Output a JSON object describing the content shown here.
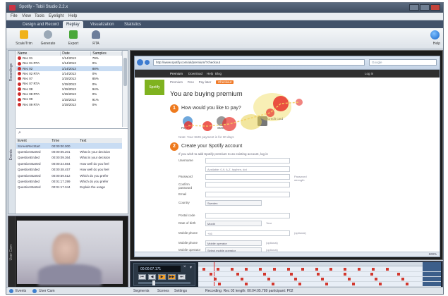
{
  "window": {
    "title": "Spotify - Tobii Studio 2.2.x",
    "colors": {
      "accent": "#ee7a1e",
      "gaze": "#e8322b",
      "titlebar": "#3f4d60"
    }
  },
  "menu": [
    "File",
    "View",
    "Tools",
    "Eyelight",
    "Help"
  ],
  "tabs": [
    "Design and Record",
    "Replay",
    "Visualization",
    "Statistics"
  ],
  "toolbar": {
    "buttons": [
      {
        "label": "Scale/Trim",
        "icon": "scale-icon"
      },
      {
        "label": "Generate",
        "icon": "generate-icon"
      },
      {
        "label": "Export",
        "icon": "export-icon"
      },
      {
        "label": "RTA",
        "icon": "rta-icon"
      }
    ],
    "help_label": "Help"
  },
  "recordings": {
    "panel_label": "Recordings",
    "columns": [
      "Name",
      "Date",
      "Samples"
    ],
    "rows": [
      {
        "name": "Rec 01",
        "date": "1/14/2013",
        "samples": "79%"
      },
      {
        "name": "Rec 01 RTA",
        "date": "1/14/2013",
        "samples": "0%"
      },
      {
        "name": "Rec 02",
        "date": "1/14/2013",
        "samples": "88%"
      },
      {
        "name": "Rec 02 RTA",
        "date": "1/14/2013",
        "samples": "0%"
      },
      {
        "name": "Rec 07",
        "date": "1/15/2013",
        "samples": "85%"
      },
      {
        "name": "Rec 07 RTA",
        "date": "1/15/2013",
        "samples": "0%"
      },
      {
        "name": "Rec 08",
        "date": "1/15/2013",
        "samples": "94%"
      },
      {
        "name": "Rec 08 RTA",
        "date": "1/15/2013",
        "samples": "0%"
      },
      {
        "name": "Rec 09",
        "date": "1/15/2013",
        "samples": "91%"
      },
      {
        "name": "Rec 09 RTA",
        "date": "1/15/2013",
        "samples": "0%"
      }
    ]
  },
  "segments": {
    "panel_label": "Events",
    "columns": [
      "Event",
      "Time",
      "Text"
    ],
    "rows": [
      {
        "event": "ScreenRecStart",
        "time": "00:00:00.000",
        "text": ""
      },
      {
        "event": "QuestionStarted",
        "time": "00:00:05.201",
        "text": "What is your decision"
      },
      {
        "event": "QuestionEnded",
        "time": "00:00:09.364",
        "text": "What is your decision"
      },
      {
        "event": "QuestionStarted",
        "time": "00:00:24.564",
        "text": "How well do you feel"
      },
      {
        "event": "QuestionEnded",
        "time": "00:00:48.457",
        "text": "How well do you feel"
      },
      {
        "event": "QuestionStarted",
        "time": "00:00:59.512",
        "text": "Which do you prefer"
      },
      {
        "event": "QuestionEnded",
        "time": "00:01:17.299",
        "text": "Which do you prefer"
      },
      {
        "event": "QuestionStarted",
        "time": "00:01:17.344",
        "text": "Explain the usage"
      }
    ]
  },
  "side_tabs": {
    "user_cam": "User Cam"
  },
  "browser": {
    "address": "http://www.spotify.com/uk/premium/?checkout",
    "search_placeholder": "Google",
    "site_nav": [
      "Premium",
      "Download",
      "Help",
      "Blog"
    ],
    "site_nav_right": "Log in",
    "logo": "Spotify",
    "crumbs": [
      "Premium",
      "Free",
      "Pay later",
      "Checkout"
    ],
    "heading": "You are buying premium",
    "step1": {
      "number": "1",
      "question": "How would you like to pay?"
    },
    "pay_options": [
      "PayPal",
      "SMS",
      "Credit card"
    ],
    "pay_hint": "Note: Your SMS payment is for 30 days",
    "step2": {
      "number": "2",
      "question": "Create your Spotify account"
    },
    "step2_note": "If you wish to add Spotify premium to an existing account, log in",
    "fields": [
      {
        "label": "Username",
        "value": "",
        "hint": ""
      },
      {
        "label": "",
        "value": "Available: 0-9, A-Z, hyphen, dot",
        "hint": ""
      },
      {
        "label": "Password",
        "value": "",
        "hint": "Password strength"
      },
      {
        "label": "Confirm password",
        "value": "",
        "hint": ""
      },
      {
        "label": "Email",
        "value": "",
        "hint": ""
      },
      {
        "label": "Country",
        "value": "Sweden",
        "hint": ""
      },
      {
        "label": "Postal code",
        "value": "",
        "hint": ""
      },
      {
        "label": "Date of birth",
        "value": "Month",
        "hint": "Year"
      },
      {
        "label": "Mobile phone",
        "value": "+46",
        "hint": "(optional)"
      },
      {
        "label": "Mobile phone",
        "value": "Mobile operator",
        "hint": "(optional)"
      },
      {
        "label": "Mobile operator",
        "value": "Select mobile operator",
        "hint": "(optional)"
      }
    ],
    "zoom": "100%"
  },
  "playback": {
    "time": "00:00:07.171",
    "controls": [
      "⏮",
      "◀",
      "▶",
      "▶▶",
      "⏭"
    ]
  },
  "status": {
    "left": [
      "Events",
      "User Cam"
    ],
    "tabs": [
      "Segments",
      "Scenes",
      "Settings"
    ],
    "recording": "Recording: Rec 02  length: 00:04:05.789  participant: P02"
  }
}
